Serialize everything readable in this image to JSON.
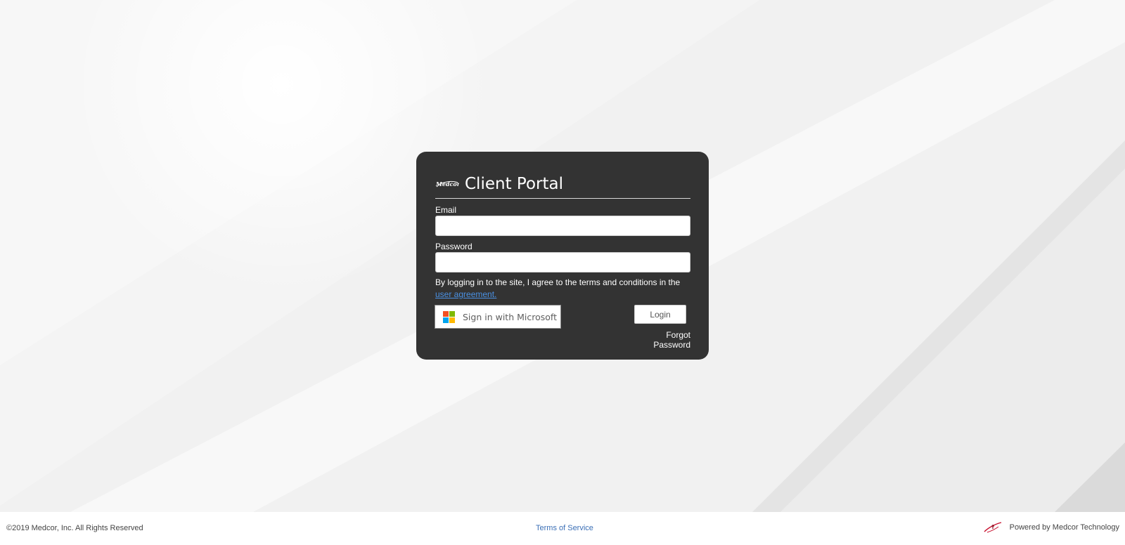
{
  "card": {
    "title": "Client Portal",
    "logo_name": "medcor-logo",
    "logo_text": "Medcor"
  },
  "form": {
    "email_label": "Email",
    "email_value": "",
    "password_label": "Password",
    "password_value": "",
    "agreement_text": "By logging in to the site, I agree to the terms and conditions in the",
    "agreement_link": "user agreement.",
    "microsoft_button": "Sign in with Microsoft",
    "login_button": "Login",
    "forgot_password": "Forgot Password"
  },
  "footer": {
    "copyright": "©2019 Medcor, Inc. All Rights Reserved",
    "terms": "Terms of Service",
    "powered_by": "Powered by Medcor Technology"
  },
  "colors": {
    "card_bg": "#333333",
    "link": "#4a90e2",
    "ms_red": "#f25022",
    "ms_green": "#7fba00",
    "ms_blue": "#00a4ef",
    "ms_yellow": "#ffb900",
    "brand_red": "#c8102e"
  }
}
